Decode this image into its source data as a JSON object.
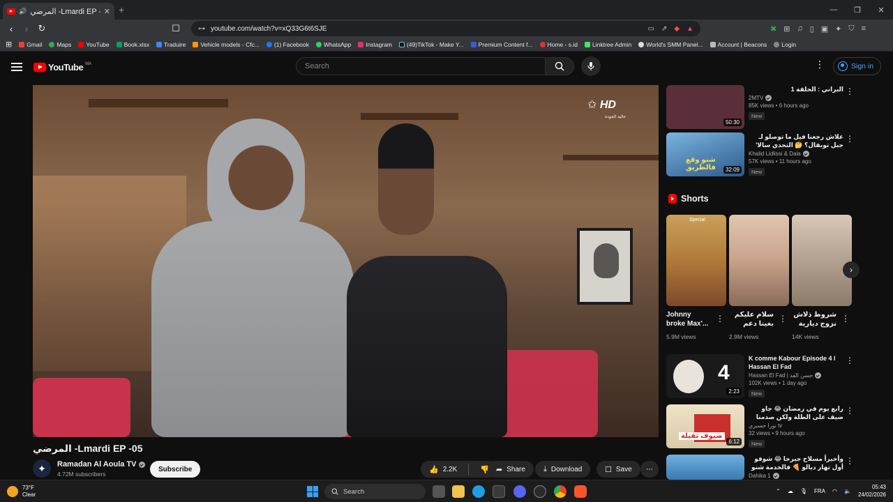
{
  "browser": {
    "tab_title": "المرضي -Lmardi EP -05 - YouTube",
    "url": "youtube.com/watch?v=xQ33G6t6SJE",
    "bookmarks": [
      "Gmail",
      "Maps",
      "YouTube",
      "Book.xlsx",
      "Traduire",
      "Vehicle models - Cfc...",
      "(1) Facebook",
      "WhatsApp",
      "Instagram",
      "(49)TikTok - Make Y...",
      "Premium Content f...",
      "Home - s.id",
      "Linktree Admin",
      "World's SMM Panel...",
      "Account | Beacons",
      "Login"
    ]
  },
  "masthead": {
    "logo": "YouTube",
    "region": "MA",
    "search_placeholder": "Search",
    "sign_in": "Sign in"
  },
  "video": {
    "overlay_logo": "HD",
    "overlay_sub": "عالية الجودة",
    "title": "المرضي -Lmardi EP -05",
    "channel": "Ramadan Al Aoula TV",
    "subscribers": "4.72M subscribers",
    "subscribe": "Subscribe",
    "likes": "2.2K",
    "share": "Share",
    "download": "Download",
    "save": "Save"
  },
  "sidebar": {
    "top": [
      {
        "title": "البراني : الحلقة 1",
        "channel": "2MTV",
        "views": "85K views • 6 hours ago",
        "badge": "New",
        "duration": "50:30",
        "color": "#5a2f3a"
      },
      {
        "title": "علاش رجعنا فيل ما توصلو لـ جبل توبقال؟ 🤔 التحدي سالا' هل مايفنا",
        "channel": "Khalid Lidlissi & Dala",
        "views": "57K views • 11 hours ago",
        "badge": "New",
        "duration": "32:09",
        "color": "#2d5a8a",
        "thumb_text": "شنو وقع فالطريق"
      }
    ],
    "shorts_header": "Shorts",
    "shorts": [
      {
        "title": "Johnny broke Max'...",
        "views": "5.9M views",
        "tag": "Special",
        "color": "#b07a3a"
      },
      {
        "title": "سلام عليكم بغينا دعم ديالكم 💗",
        "views": "2.9M views",
        "color": "#c9a28a"
      },
      {
        "title": "شروط ذلاش نزوج ديارية 🤣🤣...",
        "views": "14K views",
        "color": "#8c7a6a"
      }
    ],
    "bottom": [
      {
        "title": "K comme Kabour Episode 4 l Hassan El Fad",
        "channel": "Hassan El Fad | حسن الفد",
        "views": "102K views • 1 day ago",
        "badge": "New",
        "duration": "2:23",
        "color": "#1a1a1a",
        "thumb_text": "4"
      },
      {
        "title": "رابع يوم في رمضان 😂 جاو ضيف على الطلة ولكن صدمنا فيا 🌿",
        "channel": "نورا حسبري tv",
        "views": "32 views • 9 hours ago",
        "badge": "New",
        "duration": "6:12",
        "color": "#d9c9a8",
        "thumb_text": "ضيوف ثقيلة"
      },
      {
        "title": "وأخيراً مسلاح جيرحا 😂 شوفو أول تهار ديالو 🍕 فالخدمة شنو وقع!",
        "channel": "Dahika 1",
        "views": "",
        "badge": "",
        "duration": "",
        "color": "#3a7ab0"
      }
    ]
  },
  "taskbar": {
    "temp": "73°F",
    "condition": "Clear",
    "search": "Search",
    "lang": "FRA",
    "time": "05:43",
    "date": "24/02/2026"
  },
  "icons": {
    "like": "thumbs-up-icon",
    "dislike": "thumbs-down-icon",
    "share": "share-icon",
    "download": "download-icon",
    "save": "save-icon"
  }
}
